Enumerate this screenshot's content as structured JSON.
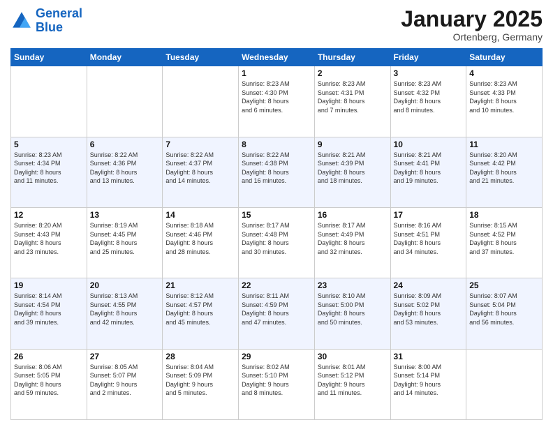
{
  "header": {
    "logo_line1": "General",
    "logo_line2": "Blue",
    "month": "January 2025",
    "location": "Ortenberg, Germany"
  },
  "weekdays": [
    "Sunday",
    "Monday",
    "Tuesday",
    "Wednesday",
    "Thursday",
    "Friday",
    "Saturday"
  ],
  "weeks": [
    [
      {
        "day": "",
        "info": ""
      },
      {
        "day": "",
        "info": ""
      },
      {
        "day": "",
        "info": ""
      },
      {
        "day": "1",
        "info": "Sunrise: 8:23 AM\nSunset: 4:30 PM\nDaylight: 8 hours\nand 6 minutes."
      },
      {
        "day": "2",
        "info": "Sunrise: 8:23 AM\nSunset: 4:31 PM\nDaylight: 8 hours\nand 7 minutes."
      },
      {
        "day": "3",
        "info": "Sunrise: 8:23 AM\nSunset: 4:32 PM\nDaylight: 8 hours\nand 8 minutes."
      },
      {
        "day": "4",
        "info": "Sunrise: 8:23 AM\nSunset: 4:33 PM\nDaylight: 8 hours\nand 10 minutes."
      }
    ],
    [
      {
        "day": "5",
        "info": "Sunrise: 8:23 AM\nSunset: 4:34 PM\nDaylight: 8 hours\nand 11 minutes."
      },
      {
        "day": "6",
        "info": "Sunrise: 8:22 AM\nSunset: 4:36 PM\nDaylight: 8 hours\nand 13 minutes."
      },
      {
        "day": "7",
        "info": "Sunrise: 8:22 AM\nSunset: 4:37 PM\nDaylight: 8 hours\nand 14 minutes."
      },
      {
        "day": "8",
        "info": "Sunrise: 8:22 AM\nSunset: 4:38 PM\nDaylight: 8 hours\nand 16 minutes."
      },
      {
        "day": "9",
        "info": "Sunrise: 8:21 AM\nSunset: 4:39 PM\nDaylight: 8 hours\nand 18 minutes."
      },
      {
        "day": "10",
        "info": "Sunrise: 8:21 AM\nSunset: 4:41 PM\nDaylight: 8 hours\nand 19 minutes."
      },
      {
        "day": "11",
        "info": "Sunrise: 8:20 AM\nSunset: 4:42 PM\nDaylight: 8 hours\nand 21 minutes."
      }
    ],
    [
      {
        "day": "12",
        "info": "Sunrise: 8:20 AM\nSunset: 4:43 PM\nDaylight: 8 hours\nand 23 minutes."
      },
      {
        "day": "13",
        "info": "Sunrise: 8:19 AM\nSunset: 4:45 PM\nDaylight: 8 hours\nand 25 minutes."
      },
      {
        "day": "14",
        "info": "Sunrise: 8:18 AM\nSunset: 4:46 PM\nDaylight: 8 hours\nand 28 minutes."
      },
      {
        "day": "15",
        "info": "Sunrise: 8:17 AM\nSunset: 4:48 PM\nDaylight: 8 hours\nand 30 minutes."
      },
      {
        "day": "16",
        "info": "Sunrise: 8:17 AM\nSunset: 4:49 PM\nDaylight: 8 hours\nand 32 minutes."
      },
      {
        "day": "17",
        "info": "Sunrise: 8:16 AM\nSunset: 4:51 PM\nDaylight: 8 hours\nand 34 minutes."
      },
      {
        "day": "18",
        "info": "Sunrise: 8:15 AM\nSunset: 4:52 PM\nDaylight: 8 hours\nand 37 minutes."
      }
    ],
    [
      {
        "day": "19",
        "info": "Sunrise: 8:14 AM\nSunset: 4:54 PM\nDaylight: 8 hours\nand 39 minutes."
      },
      {
        "day": "20",
        "info": "Sunrise: 8:13 AM\nSunset: 4:55 PM\nDaylight: 8 hours\nand 42 minutes."
      },
      {
        "day": "21",
        "info": "Sunrise: 8:12 AM\nSunset: 4:57 PM\nDaylight: 8 hours\nand 45 minutes."
      },
      {
        "day": "22",
        "info": "Sunrise: 8:11 AM\nSunset: 4:59 PM\nDaylight: 8 hours\nand 47 minutes."
      },
      {
        "day": "23",
        "info": "Sunrise: 8:10 AM\nSunset: 5:00 PM\nDaylight: 8 hours\nand 50 minutes."
      },
      {
        "day": "24",
        "info": "Sunrise: 8:09 AM\nSunset: 5:02 PM\nDaylight: 8 hours\nand 53 minutes."
      },
      {
        "day": "25",
        "info": "Sunrise: 8:07 AM\nSunset: 5:04 PM\nDaylight: 8 hours\nand 56 minutes."
      }
    ],
    [
      {
        "day": "26",
        "info": "Sunrise: 8:06 AM\nSunset: 5:05 PM\nDaylight: 8 hours\nand 59 minutes."
      },
      {
        "day": "27",
        "info": "Sunrise: 8:05 AM\nSunset: 5:07 PM\nDaylight: 9 hours\nand 2 minutes."
      },
      {
        "day": "28",
        "info": "Sunrise: 8:04 AM\nSunset: 5:09 PM\nDaylight: 9 hours\nand 5 minutes."
      },
      {
        "day": "29",
        "info": "Sunrise: 8:02 AM\nSunset: 5:10 PM\nDaylight: 9 hours\nand 8 minutes."
      },
      {
        "day": "30",
        "info": "Sunrise: 8:01 AM\nSunset: 5:12 PM\nDaylight: 9 hours\nand 11 minutes."
      },
      {
        "day": "31",
        "info": "Sunrise: 8:00 AM\nSunset: 5:14 PM\nDaylight: 9 hours\nand 14 minutes."
      },
      {
        "day": "",
        "info": ""
      }
    ]
  ]
}
